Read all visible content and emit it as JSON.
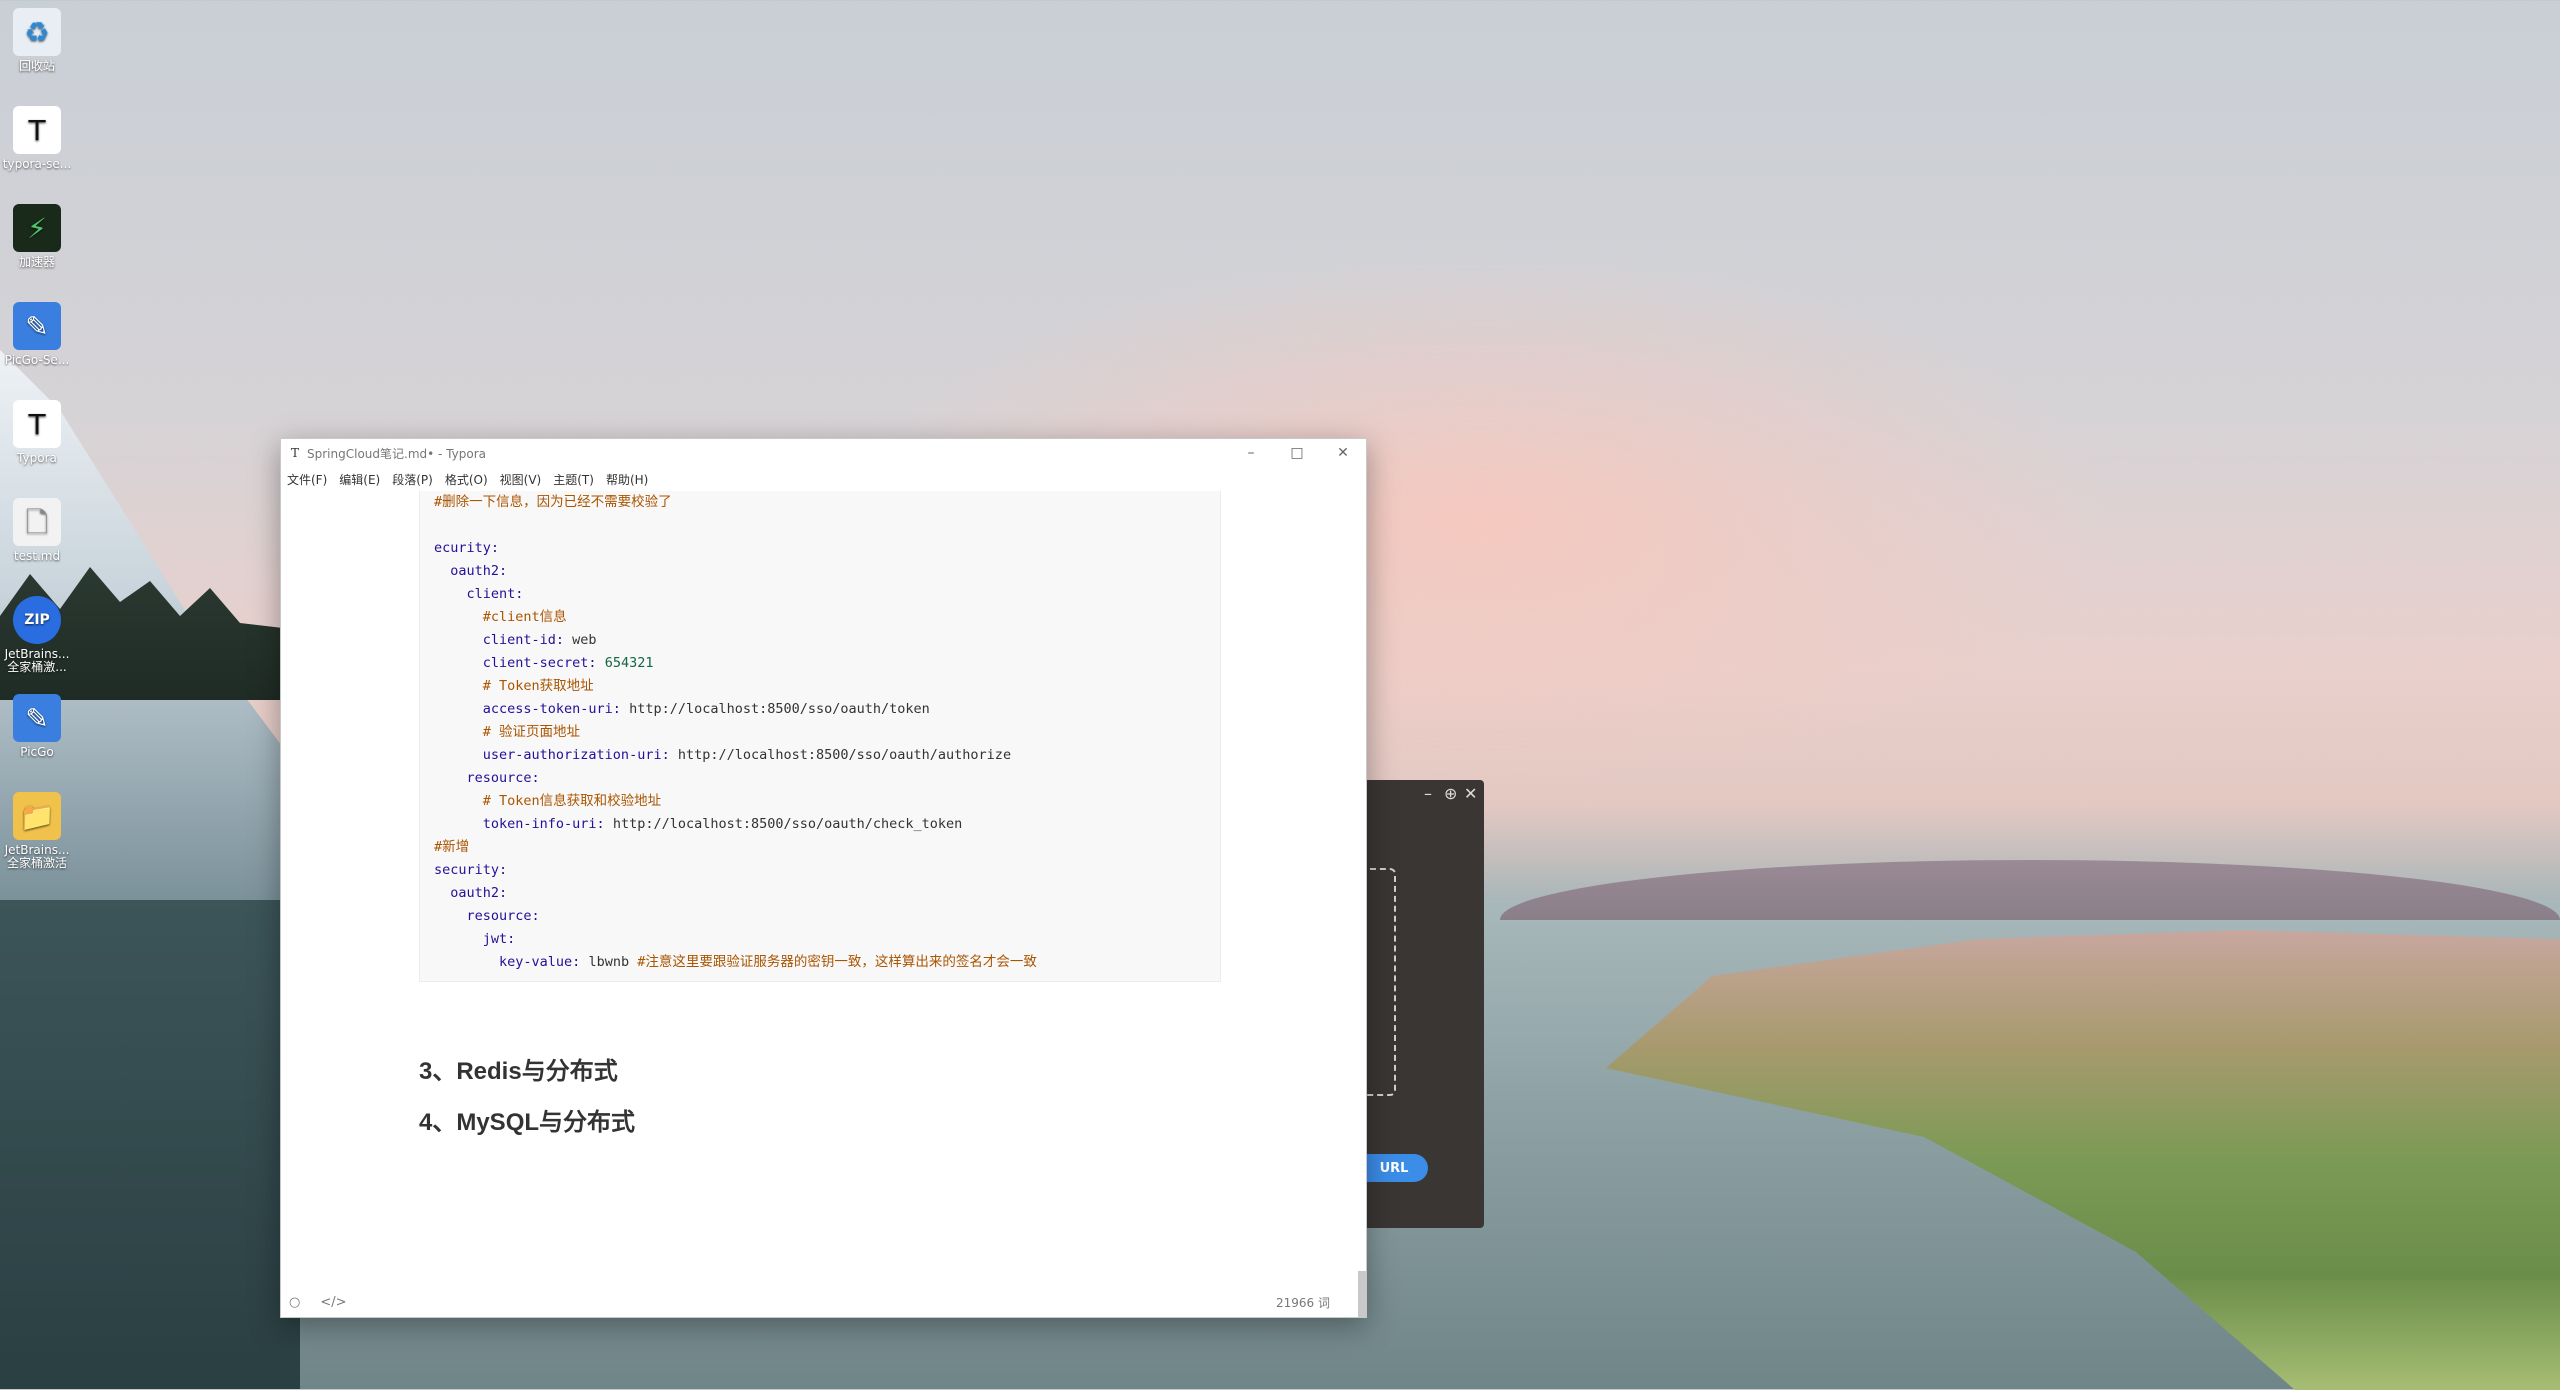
{
  "desktop": {
    "icons": [
      {
        "label": "回收站",
        "glyph": "♻"
      },
      {
        "label": "typora-se...",
        "glyph": "T"
      },
      {
        "label": "加速器",
        "glyph": "⚡"
      },
      {
        "label": "PicGo-Se...",
        "glyph": "✎"
      },
      {
        "label": "Typora",
        "glyph": "T"
      },
      {
        "label": "test.md",
        "glyph": "🗋"
      },
      {
        "label": "JetBrains...全家桶激...",
        "glyph": "ZIP"
      },
      {
        "label": "PicGo",
        "glyph": "✎"
      },
      {
        "label": "JetBrains...全家桶激活",
        "glyph": "📁"
      }
    ]
  },
  "typora": {
    "title": "SpringCloud笔记.md• - Typora",
    "title_icon": "T",
    "controls": {
      "minimize": "–",
      "maximize": "□",
      "close": "✕"
    },
    "menu": [
      "文件(F)",
      "编辑(E)",
      "段落(P)",
      "格式(O)",
      "视图(V)",
      "主题(T)",
      "帮助(H)"
    ],
    "code_lines": [
      {
        "parts": [
          {
            "t": "#删除一下信息，因为已经不需要校验了",
            "c": "c"
          }
        ]
      },
      {
        "parts": []
      },
      {
        "parts": [
          {
            "t": "ecurity:",
            "c": "k"
          }
        ]
      },
      {
        "parts": [
          {
            "t": "  oauth2:",
            "c": "k"
          }
        ]
      },
      {
        "parts": [
          {
            "t": "    client:",
            "c": "k"
          }
        ]
      },
      {
        "parts": [
          {
            "t": "      #client信息",
            "c": "c"
          }
        ]
      },
      {
        "parts": [
          {
            "t": "      client-id:",
            "c": "k"
          },
          {
            "t": " web",
            "c": "v"
          }
        ]
      },
      {
        "parts": [
          {
            "t": "      client-secret:",
            "c": "k"
          },
          {
            "t": " 654321",
            "c": "n"
          }
        ]
      },
      {
        "parts": [
          {
            "t": "      # Token获取地址",
            "c": "c"
          }
        ]
      },
      {
        "parts": [
          {
            "t": "      access-token-uri:",
            "c": "k"
          },
          {
            "t": " http://localhost:8500/sso/oauth/token",
            "c": "v"
          }
        ]
      },
      {
        "parts": [
          {
            "t": "      # 验证页面地址",
            "c": "c"
          }
        ]
      },
      {
        "parts": [
          {
            "t": "      user-authorization-uri:",
            "c": "k"
          },
          {
            "t": " http://localhost:8500/sso/oauth/authorize",
            "c": "v"
          }
        ]
      },
      {
        "parts": [
          {
            "t": "    resource:",
            "c": "k"
          }
        ]
      },
      {
        "parts": [
          {
            "t": "      # Token信息获取和校验地址",
            "c": "c"
          }
        ]
      },
      {
        "parts": [
          {
            "t": "      token-info-uri:",
            "c": "k"
          },
          {
            "t": " http://localhost:8500/sso/oauth/check_token",
            "c": "v"
          }
        ]
      },
      {
        "parts": [
          {
            "t": "#新增",
            "c": "c"
          }
        ]
      },
      {
        "parts": [
          {
            "t": "security:",
            "c": "k"
          }
        ]
      },
      {
        "parts": [
          {
            "t": "  oauth2:",
            "c": "k"
          }
        ]
      },
      {
        "parts": [
          {
            "t": "    resource:",
            "c": "k"
          }
        ]
      },
      {
        "parts": [
          {
            "t": "      jwt:",
            "c": "k"
          }
        ]
      },
      {
        "parts": [
          {
            "t": "        key-value:",
            "c": "k"
          },
          {
            "t": " lbwnb ",
            "c": "v"
          },
          {
            "t": "#注意这里要跟验证服务器的密钥一致，这样算出来的签名才会一致",
            "c": "c"
          }
        ]
      }
    ],
    "headings": [
      "3、Redis与分布式",
      "4、MySQL与分布式"
    ],
    "status": {
      "word_count": "21966 词",
      "outline_icon": "○",
      "source_icon": "</>"
    }
  },
  "picgo": {
    "controls": {
      "minimize": "–",
      "pin": "⊕",
      "close": "✕"
    },
    "url_button": "URL"
  }
}
